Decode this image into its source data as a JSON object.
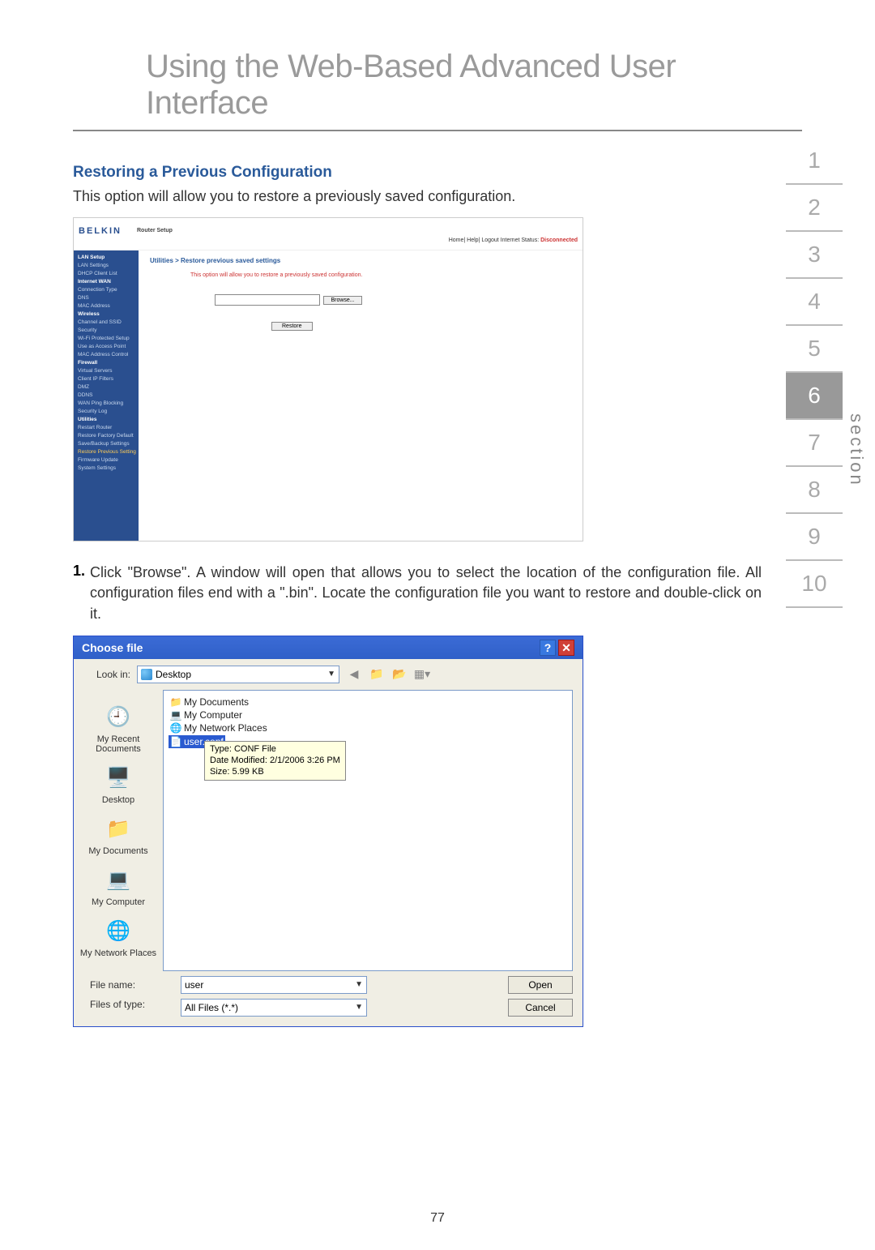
{
  "page_title": "Using the Web-Based Advanced User Interface",
  "section_nav": [
    "1",
    "2",
    "3",
    "4",
    "5",
    "6",
    "7",
    "8",
    "9",
    "10"
  ],
  "section_nav_active": "6",
  "section_label": "section",
  "subheading": "Restoring a Previous Configuration",
  "intro_text": "This option will allow you to restore a previously saved configuration.",
  "router": {
    "logo": "BELKIN",
    "setup_label": "Router Setup",
    "top_links_prefix": "Home| Help| Logout   Internet Status: ",
    "top_links_status": "Disconnected",
    "sidebar": {
      "groups": [
        {
          "header": "LAN Setup",
          "items": [
            "LAN Settings",
            "DHCP Client List"
          ]
        },
        {
          "header": "Internet WAN",
          "items": [
            "Connection Type",
            "DNS",
            "MAC Address"
          ]
        },
        {
          "header": "Wireless",
          "items": [
            "Channel and SSID",
            "Security",
            "Wi-Fi Protected Setup",
            "Use as Access Point",
            "MAC Address Control"
          ]
        },
        {
          "header": "Firewall",
          "items": [
            "Virtual Servers",
            "Client IP Filters",
            "DMZ",
            "DDNS",
            "WAN Ping Blocking",
            "Security Log"
          ]
        },
        {
          "header": "Utilities",
          "items": [
            "Restart Router",
            "Restore Factory Default",
            "Save/Backup Settings",
            "Restore Previous Settings",
            "Firmware Update",
            "System Settings"
          ]
        }
      ],
      "active_item": "Restore Previous Settings"
    },
    "breadcrumb": "Utilities > Restore previous saved settings",
    "desc": "This option will allow you to restore a previously saved configuration.",
    "browse_btn": "Browse...",
    "restore_btn": "Restore"
  },
  "step1": {
    "num": "1.",
    "text": "Click \"Browse\". A window will open that allows you to select the location of the configuration file. All configuration files end with a \".bin\". Locate the configuration file you want to restore and double-click on it."
  },
  "filedialog": {
    "title": "Choose file",
    "lookin_label": "Look in:",
    "lookin_value": "Desktop",
    "places": [
      "My Recent Documents",
      "Desktop",
      "My Documents",
      "My Computer",
      "My Network Places"
    ],
    "files": [
      {
        "name": "My Documents",
        "icon": "folder"
      },
      {
        "name": "My Computer",
        "icon": "computer"
      },
      {
        "name": "My Network Places",
        "icon": "network"
      },
      {
        "name": "user.conf",
        "icon": "conf",
        "selected": true
      }
    ],
    "tooltip": {
      "line1": "Type: CONF File",
      "line2": "Date Modified: 2/1/2006 3:26 PM",
      "line3": "Size: 5.99 KB"
    },
    "filename_label": "File name:",
    "filename_value": "user",
    "filetype_label": "Files of type:",
    "filetype_value": "All Files (*.*)",
    "open_btn": "Open",
    "cancel_btn": "Cancel"
  },
  "page_number": "77"
}
